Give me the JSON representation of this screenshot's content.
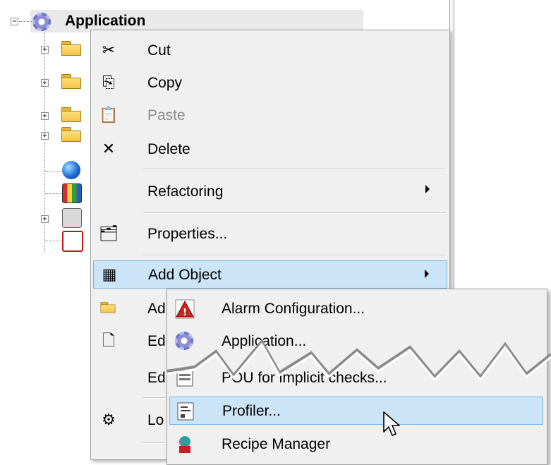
{
  "tree": {
    "root_label": "Application",
    "expander_collapsed": "+",
    "expander_expanded": "−"
  },
  "context_menu": {
    "items": [
      {
        "label": "Cut",
        "icon": "scissors-icon",
        "disabled": false
      },
      {
        "label": "Copy",
        "icon": "copy-icon",
        "disabled": false
      },
      {
        "label": "Paste",
        "icon": "paste-icon",
        "disabled": true
      },
      {
        "label": "Delete",
        "icon": "delete-x-icon",
        "disabled": false
      },
      {
        "label": "Refactoring",
        "submenu": true
      },
      {
        "label": "Properties...",
        "icon": "properties-icon"
      },
      {
        "label": "Add Object",
        "icon": "add-object-icon",
        "submenu": true,
        "selected": true
      },
      {
        "label": "Ad",
        "icon": "folder-icon"
      },
      {
        "label": "Ed",
        "icon": "edit-object-icon"
      },
      {
        "label": "Ed"
      },
      {
        "label": "Lo",
        "icon": "login-icon"
      }
    ]
  },
  "submenu": {
    "items": [
      {
        "label": "Alarm Configuration...",
        "icon": "alarm-icon"
      },
      {
        "label": "Application...",
        "icon": "gear-icon"
      },
      {
        "label": "POU for implicit checks...",
        "icon": "pou-icon"
      },
      {
        "label": "Profiler...",
        "icon": "profiler-icon",
        "selected": true
      },
      {
        "label": "Recipe Manager",
        "icon": "recipe-icon"
      }
    ]
  },
  "colors": {
    "selection_bg": "#cce4f7",
    "selection_border": "#7fb4de",
    "menu_bg": "#f0f0f0",
    "disabled_text": "#8d8d8d"
  }
}
